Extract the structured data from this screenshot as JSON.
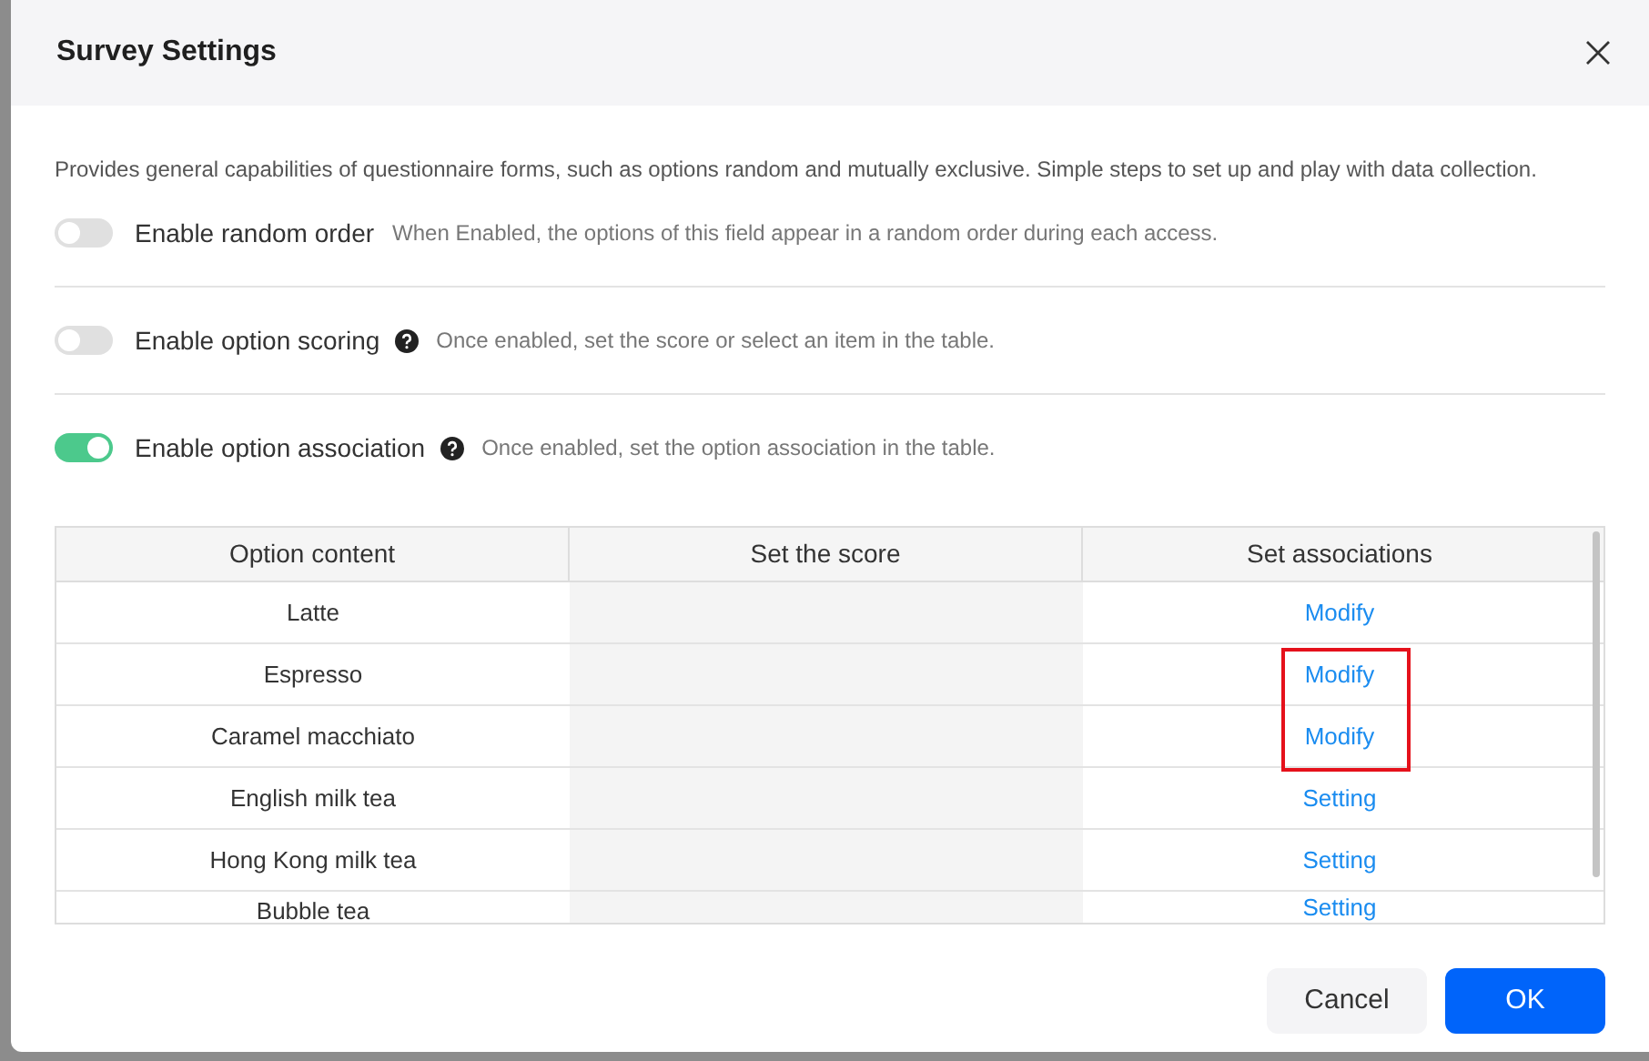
{
  "dialog": {
    "title": "Survey Settings",
    "description": "Provides general capabilities of questionnaire forms, such as options random and mutually exclusive. Simple steps to set up and play with data collection."
  },
  "settings": [
    {
      "label": "Enable random order",
      "help_icon": false,
      "on": false,
      "hint": "When Enabled, the options of this field appear in a random order during each access."
    },
    {
      "label": "Enable option scoring",
      "help_icon": true,
      "on": false,
      "hint": "Once enabled, set the score or select an item in the table."
    },
    {
      "label": "Enable option association",
      "help_icon": true,
      "on": true,
      "hint": "Once enabled, set the option association in the table."
    }
  ],
  "table": {
    "columns": [
      "Option content",
      "Set the score",
      "Set associations"
    ],
    "rows": [
      {
        "option": "Latte",
        "action": "Modify",
        "highlighted": false
      },
      {
        "option": "Espresso",
        "action": "Modify",
        "highlighted": true
      },
      {
        "option": "Caramel macchiato",
        "action": "Modify",
        "highlighted": true
      },
      {
        "option": "English milk tea",
        "action": "Setting",
        "highlighted": false
      },
      {
        "option": "Hong Kong milk tea",
        "action": "Setting",
        "highlighted": false
      },
      {
        "option": "Bubble tea",
        "action": "Setting",
        "highlighted": false
      }
    ]
  },
  "buttons": [
    {
      "label": "Cancel",
      "kind": "secondary"
    },
    {
      "label": "OK",
      "kind": "primary"
    }
  ]
}
